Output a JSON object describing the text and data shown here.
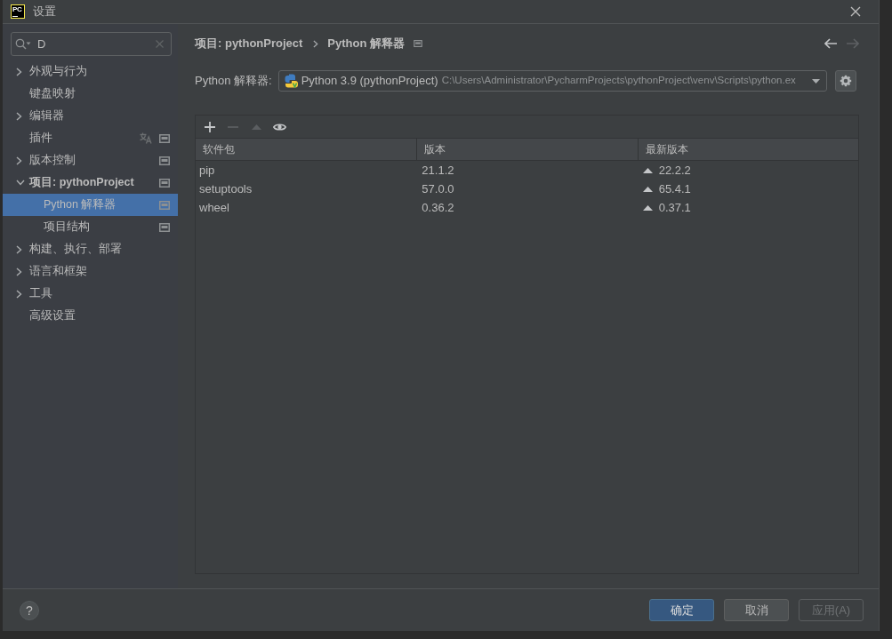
{
  "window": {
    "logo_text": "PC",
    "title": "设置"
  },
  "search": {
    "value": "D"
  },
  "tree": [
    {
      "label": "外观与行为",
      "kind": "group",
      "expanded": false,
      "selected": false,
      "bold": false,
      "project_level": false,
      "localized": false
    },
    {
      "label": "键盘映射",
      "kind": "leaf",
      "selected": false,
      "bold": false,
      "project_level": false,
      "localized": false
    },
    {
      "label": "编辑器",
      "kind": "group",
      "expanded": false,
      "selected": false,
      "bold": false,
      "project_level": false,
      "localized": false
    },
    {
      "label": "插件",
      "kind": "leaf",
      "selected": false,
      "bold": false,
      "project_level": true,
      "localized": true
    },
    {
      "label": "版本控制",
      "kind": "group",
      "expanded": false,
      "selected": false,
      "bold": false,
      "project_level": true,
      "localized": false
    },
    {
      "label": "项目: pythonProject",
      "kind": "group",
      "expanded": true,
      "selected": false,
      "bold": true,
      "project_level": true,
      "localized": false,
      "children": [
        {
          "label": "Python 解释器",
          "selected": true,
          "bold": false,
          "project_level": true,
          "localized": false
        },
        {
          "label": "项目结构",
          "selected": false,
          "bold": false,
          "project_level": true,
          "localized": false
        }
      ]
    },
    {
      "label": "构建、执行、部署",
      "kind": "group",
      "expanded": false,
      "selected": false,
      "bold": false,
      "project_level": false,
      "localized": false
    },
    {
      "label": "语言和框架",
      "kind": "group",
      "expanded": false,
      "selected": false,
      "bold": false,
      "project_level": false,
      "localized": false
    },
    {
      "label": "工具",
      "kind": "group",
      "expanded": false,
      "selected": false,
      "bold": false,
      "project_level": false,
      "localized": false
    },
    {
      "label": "高级设置",
      "kind": "leaf",
      "selected": false,
      "bold": false,
      "project_level": false,
      "localized": false
    }
  ],
  "breadcrumb": {
    "items": [
      "项目: pythonProject",
      "Python 解释器"
    ],
    "project_level": true
  },
  "navigation": [
    {
      "kind": "back",
      "disabled": false
    },
    {
      "kind": "forward",
      "disabled": true
    }
  ],
  "interpreter": {
    "label": "Python 解释器:",
    "name": "Python 3.9 (pythonProject)",
    "path": "C:\\Users\\Administrator\\PycharmProjects\\pythonProject\\venv\\Scripts\\python.ex"
  },
  "packages": {
    "toolbar": [
      {
        "kind": "add",
        "disabled": false
      },
      {
        "kind": "remove",
        "disabled": true
      },
      {
        "kind": "upgrade",
        "disabled": true
      },
      {
        "kind": "show",
        "disabled": false
      }
    ],
    "columns": [
      "软件包",
      "版本",
      "最新版本"
    ],
    "rows": [
      {
        "package": "pip",
        "version": "21.1.2",
        "latest": "22.2.2",
        "upgrade": true
      },
      {
        "package": "setuptools",
        "version": "57.0.0",
        "latest": "65.4.1",
        "upgrade": true
      },
      {
        "package": "wheel",
        "version": "0.36.2",
        "latest": "0.37.1",
        "upgrade": true
      }
    ]
  },
  "footer": {
    "help": "?",
    "buttons": [
      {
        "label": "确定",
        "primary": true,
        "disabled": false
      },
      {
        "label": "取消",
        "primary": false,
        "disabled": false
      },
      {
        "label": "应用(A)",
        "primary": false,
        "disabled": true
      }
    ]
  }
}
